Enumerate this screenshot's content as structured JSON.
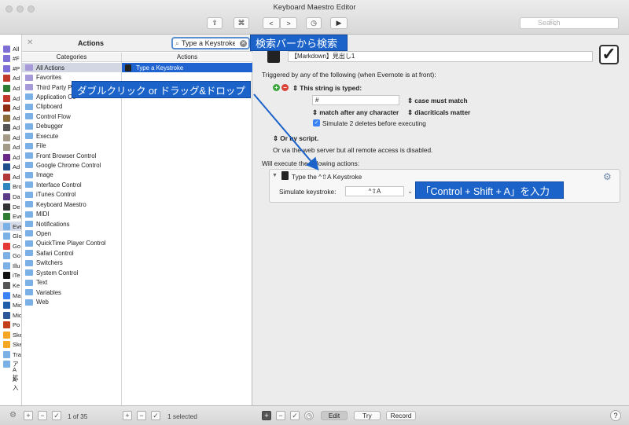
{
  "window": {
    "title": "Keyboard Maestro Editor"
  },
  "toolbar": {
    "share_icon": "share-icon",
    "cmd_label": "⌘",
    "back_label": "<",
    "forward_label": ">",
    "history_icon": "clock-icon",
    "play_label": "▶",
    "search_placeholder": "Search"
  },
  "macro_list": {
    "items": [
      {
        "label": "All",
        "color": "#7e6fd6"
      },
      {
        "label": "#F",
        "color": "#7e6fd6"
      },
      {
        "label": "#P",
        "color": "#7e6fd6"
      },
      {
        "label": "Ad",
        "color": "#c0392b"
      },
      {
        "label": "Ad",
        "color": "#2d7d32"
      },
      {
        "label": "Ad",
        "color": "#c0392b"
      },
      {
        "label": "Ad",
        "color": "#8e2b10"
      },
      {
        "label": "Ad",
        "color": "#8a6d3b"
      },
      {
        "label": "Ad",
        "color": "#555555"
      },
      {
        "label": "Ad",
        "color": "#a39a88"
      },
      {
        "label": "Ad",
        "color": "#a39a88"
      },
      {
        "label": "Ad",
        "color": "#6b2a8a"
      },
      {
        "label": "Ad",
        "color": "#1f4e8c"
      },
      {
        "label": "Ad",
        "color": "#b33939"
      },
      {
        "label": "Bro",
        "color": "#2e86c1"
      },
      {
        "label": "Da",
        "color": "#5b3c88"
      },
      {
        "label": "De",
        "color": "#333333"
      },
      {
        "label": "Eve",
        "color": "#2e7d32"
      },
      {
        "label": "Eve",
        "color": "#7bb0e6"
      },
      {
        "label": "Glo",
        "color": "#7bb0e6"
      },
      {
        "label": "Go",
        "color": "#e53935"
      },
      {
        "label": "Go",
        "color": "#7bb0e6"
      },
      {
        "label": "Illu",
        "color": "#7bb0e6"
      },
      {
        "label": "iTe",
        "color": "#111111"
      },
      {
        "label": "Ke",
        "color": "#555555"
      },
      {
        "label": "Ma",
        "color": "#3a82f7"
      },
      {
        "label": "Mic",
        "color": "#1e5ea8"
      },
      {
        "label": "Mic",
        "color": "#2b579a"
      },
      {
        "label": "Po",
        "color": "#c43e1c"
      },
      {
        "label": "Ske",
        "color": "#f5a623"
      },
      {
        "label": "Ske",
        "color": "#f5a623"
      },
      {
        "label": "Tra",
        "color": "#7bb0e6"
      },
      {
        "label": "ア",
        "color": "#7bb0e6"
      },
      {
        "label": "A 拡",
        "color": "#ffffff"
      },
      {
        "label": "A 入",
        "color": "#ffffff"
      }
    ],
    "count_label": "1 of 35"
  },
  "actions_panel": {
    "title": "Actions",
    "search_value": "Type a Keystroke",
    "categories_header": "Categories",
    "actions_header": "Actions",
    "categories": [
      "All Actions",
      "Favorites",
      "Third Party P",
      "Application Co",
      "Clipboard",
      "Control Flow",
      "Debugger",
      "Execute",
      "File",
      "Front Browser Control",
      "Google Chrome Control",
      "Image",
      "Interface Control",
      "iTunes Control",
      "Keyboard Maestro",
      "MIDI",
      "Notifications",
      "Open",
      "QuickTime Player Control",
      "Safari Control",
      "Switchers",
      "System Control",
      "Text",
      "Variables",
      "Web"
    ],
    "actions": [
      "Type a Keystroke"
    ],
    "selected_label": "1 selected"
  },
  "callouts": {
    "search": "検索バーから検索",
    "drag": "ダブルクリック or ドラッグ&ドロップ",
    "result": "「Control + Shift + A」を入力"
  },
  "editor": {
    "macro_name": "【Markdown】見出し1",
    "trigger_heading": "Triggered by any of the following (when Evernote is at front):",
    "string_typed_label": "This string is typed:",
    "trigger_value": "#",
    "case_label": "case must match",
    "after_label": "match after any character",
    "diacriticals_label": "diacriticals matter",
    "simulate_deletes": "Simulate 2 deletes before executing",
    "script_label": "Or by script.",
    "web_server_note": "Or via the web server but all remote access is disabled.",
    "will_execute": "Will execute the following actions:",
    "action_title": "Type the ^⇧A Keystroke",
    "simulate_label": "Simulate keystroke:",
    "keystroke_value": "^⇧A"
  },
  "bottom": {
    "edit_label": "Edit",
    "try_label": "Try",
    "record_label": "Record",
    "help_label": "?"
  },
  "colors": {
    "accent": "#1b63c9",
    "selection": "#1f63d1"
  }
}
